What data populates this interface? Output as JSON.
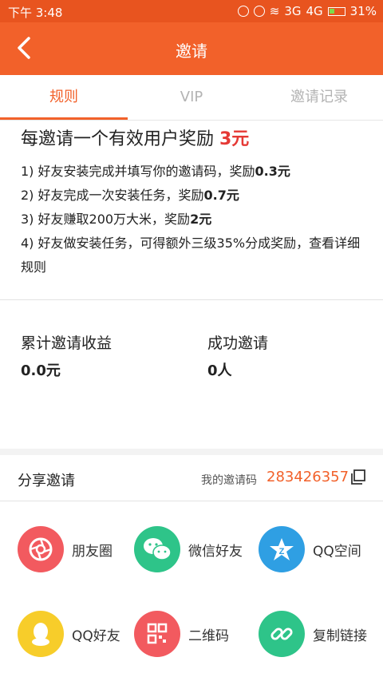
{
  "status_bar": {
    "time": "下午 3:48",
    "network": "3G",
    "network2": "4G",
    "battery": "31%"
  },
  "header": {
    "title": "邀请"
  },
  "tabs": [
    {
      "label": "规则"
    },
    {
      "label": "VIP"
    },
    {
      "label": "邀请记录"
    }
  ],
  "rules": {
    "headline_prefix": "每邀请一个有效用户奖励 ",
    "headline_amount": "3元",
    "items": [
      {
        "text": "1) 好友安装完成并填写你的邀请码，奖励",
        "reward": "0.3元"
      },
      {
        "text": "2) 好友完成一次安装任务，奖励",
        "reward": "0.7元"
      },
      {
        "text": "3) 好友赚取200万大米，奖励",
        "reward": "2元"
      },
      {
        "text": "4) 好友做安装任务，可得额外三级35%分成奖励，查看详细规则",
        "reward": ""
      }
    ]
  },
  "stats": {
    "earnings_label": "累计邀请收益",
    "earnings_value": "0.0元",
    "invites_label": "成功邀请",
    "invites_value": "0人"
  },
  "share": {
    "title": "分享邀请",
    "code_label": "我的邀请码",
    "code_value": "283426357",
    "items": [
      {
        "label": "朋友圈",
        "icon": "moments-icon",
        "color": "#f25a5f"
      },
      {
        "label": "微信好友",
        "icon": "wechat-icon",
        "color": "#2ec489"
      },
      {
        "label": "QQ空间",
        "icon": "qzone-icon",
        "color": "#2f9fe3"
      },
      {
        "label": "QQ好友",
        "icon": "qq-icon",
        "color": "#f7cd2a"
      },
      {
        "label": "二维码",
        "icon": "qrcode-icon",
        "color": "#f25a5f"
      },
      {
        "label": "复制链接",
        "icon": "link-icon",
        "color": "#2ec489"
      }
    ]
  }
}
